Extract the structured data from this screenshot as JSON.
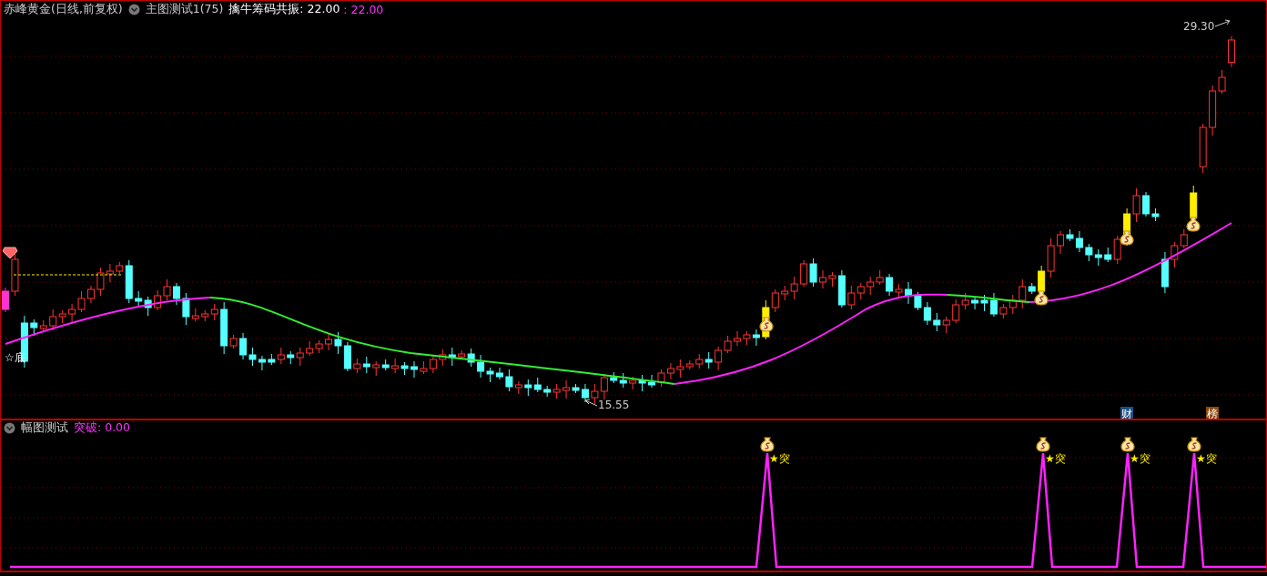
{
  "main_pane": {
    "title": "赤峰黄金(日线,前复权)",
    "indicator": "主图测试1(75)",
    "series_label": "擒牛筹码共振: 22.00",
    "series_value": ": 22.00",
    "high_label": "29.30",
    "low_label": "15.55",
    "bottom_mark": "☆底",
    "event_tags": [
      {
        "text": "财",
        "color": "#1a4f86"
      },
      {
        "text": "榜",
        "color": "#8a4a12"
      }
    ]
  },
  "sub_pane": {
    "title": "幅图测试",
    "series_label": "突破: 0.00",
    "signal_marks": [
      "★突",
      "★突",
      "★突",
      "★突"
    ]
  }
}
